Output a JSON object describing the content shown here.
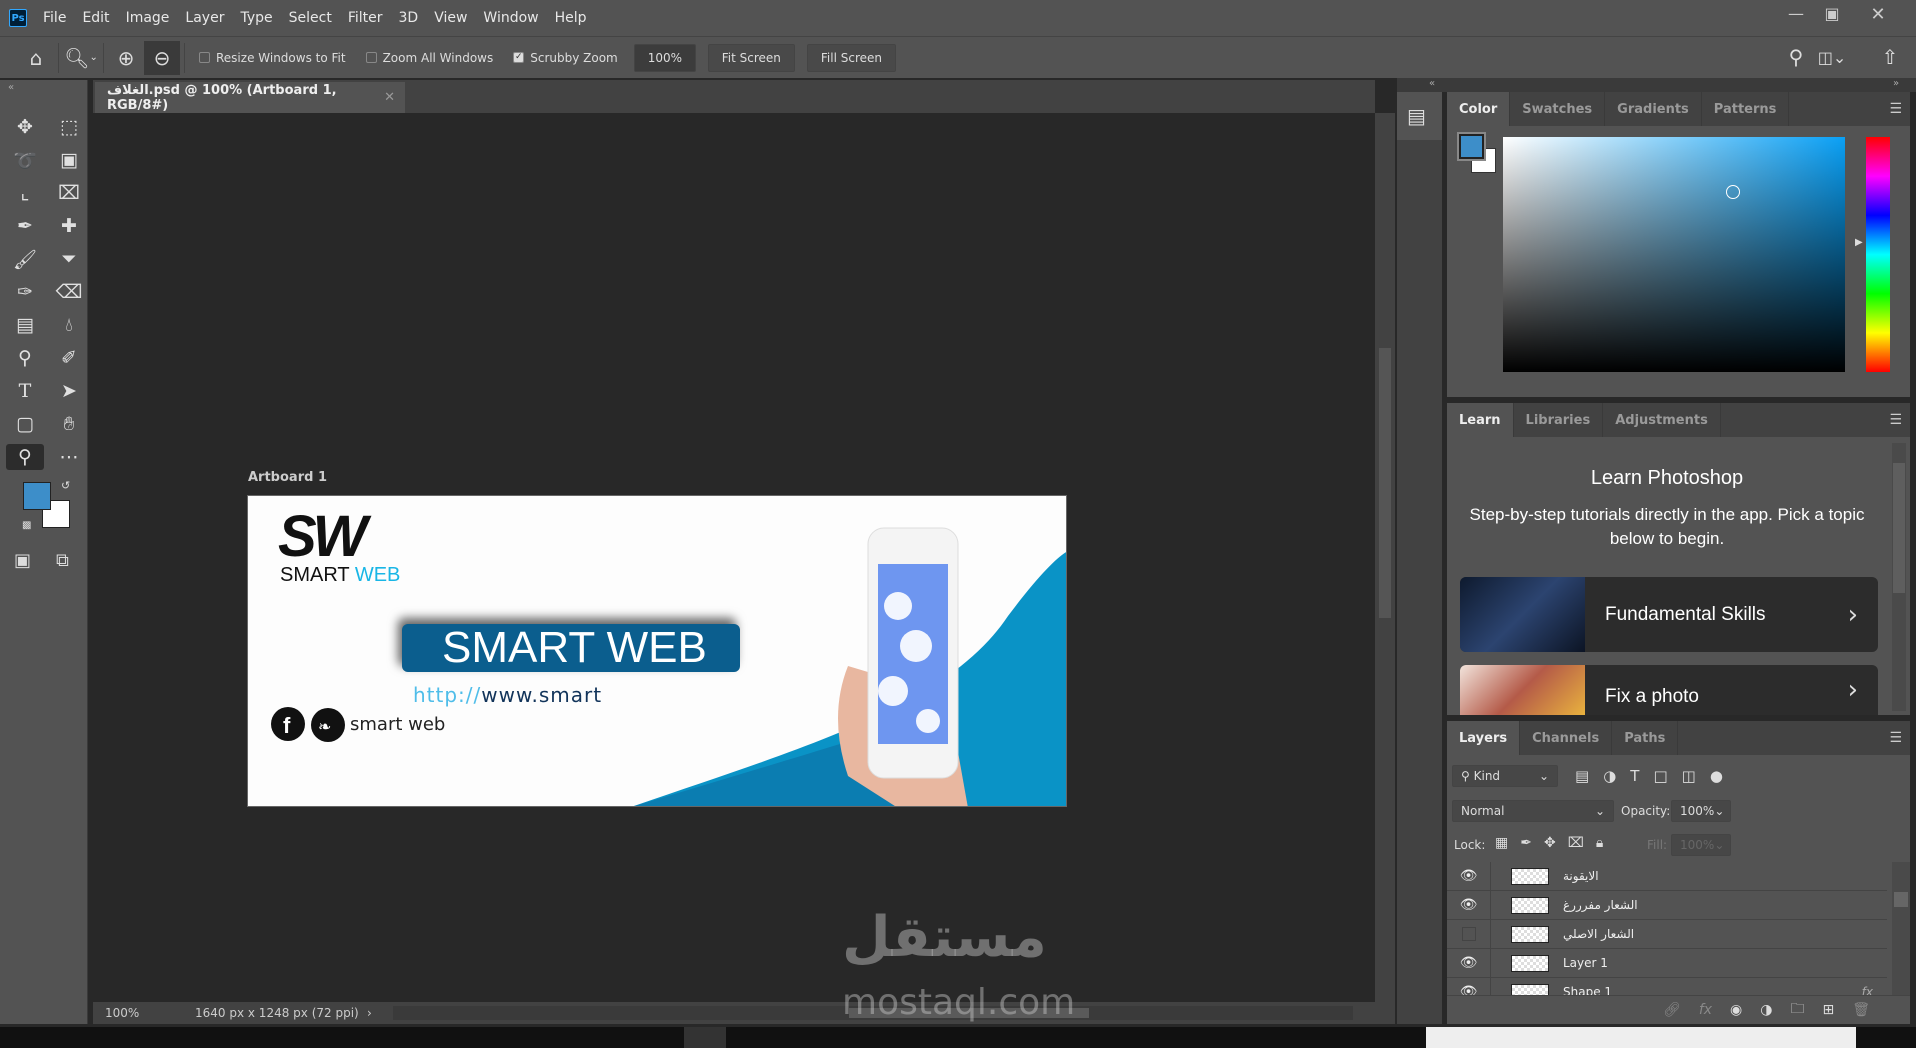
{
  "app": {
    "logo": "Ps",
    "menu": [
      "File",
      "Edit",
      "Image",
      "Layer",
      "Type",
      "Select",
      "Filter",
      "3D",
      "View",
      "Window",
      "Help"
    ],
    "window_controls": [
      "minimize-icon",
      "restore-icon",
      "close-icon"
    ]
  },
  "options": {
    "resize_windows": "Resize Windows to Fit",
    "resize_checked": false,
    "zoom_all": "Zoom All Windows",
    "zoom_all_checked": false,
    "scrubby": "Scrubby Zoom",
    "scrubby_checked": true,
    "zoom_value": "100%",
    "fit_screen": "Fit Screen",
    "fill_screen": "Fill Screen"
  },
  "document": {
    "tab_title": "الغلاف.psd @ 100% (Artboard 1, RGB/8#)",
    "artboard_label": "Artboard 1",
    "zoom": "100%",
    "dimensions": "1640 px x 1248 px (72 ppi)"
  },
  "artboard": {
    "logo_mark": "SW",
    "logo_text_1": "SMART",
    "logo_text_2": "WEB",
    "banner": "SMART WEB",
    "url_1": "http://",
    "url_2": "www.smart",
    "social_text": "smart web",
    "accent": "#0b5e8e",
    "curve_color": "#0a93c6"
  },
  "colors": {
    "foreground": "#3d8ec9",
    "background": "#ffffff"
  },
  "color_panel": {
    "tabs": [
      "Color",
      "Swatches",
      "Gradients",
      "Patterns"
    ],
    "active": 0
  },
  "learn_panel": {
    "tabs": [
      "Learn",
      "Libraries",
      "Adjustments"
    ],
    "title": "Learn Photoshop",
    "description": "Step-by-step tutorials directly in the app. Pick a topic below to begin.",
    "cards": [
      {
        "label": "Fundamental Skills"
      },
      {
        "label": "Fix a photo"
      }
    ]
  },
  "layers_panel": {
    "tabs": [
      "Layers",
      "Channels",
      "Paths"
    ],
    "filter": "Kind",
    "blend_mode": "Normal",
    "opacity_label": "Opacity:",
    "opacity": "100%",
    "lock_label": "Lock:",
    "fill_label": "Fill:",
    "fill": "100%",
    "layers": [
      {
        "name": "الايقونة",
        "visible": true
      },
      {
        "name": "الشعار مفرررغ",
        "visible": true
      },
      {
        "name": "الشعار الاصلي",
        "visible": false
      },
      {
        "name": "Layer 1",
        "visible": true
      },
      {
        "name": "Shape 1",
        "visible": true,
        "fx": "fx"
      }
    ]
  },
  "watermark": {
    "arabic": "مستقل",
    "latin": "mostaql.com"
  }
}
